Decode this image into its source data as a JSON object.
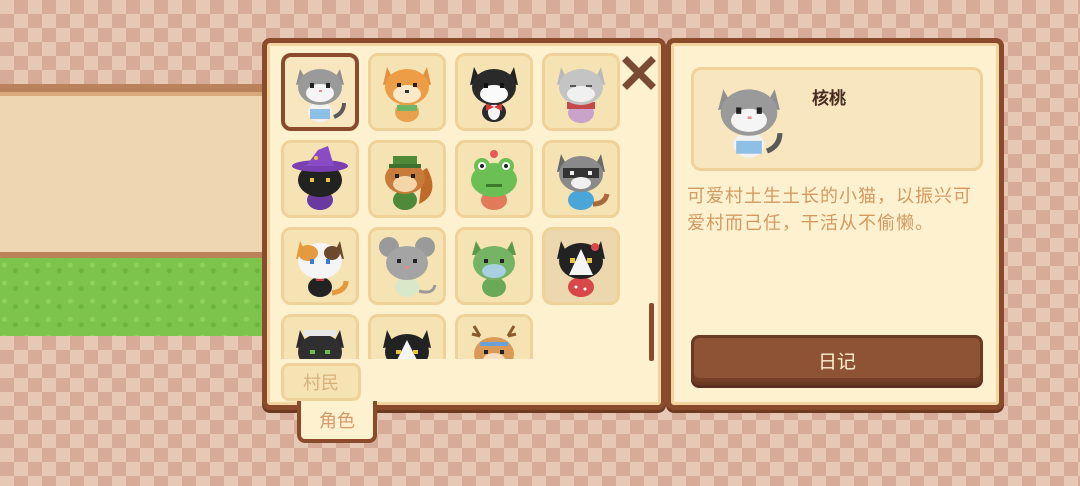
{
  "tabs": {
    "villagers": "村民",
    "characters": "角色"
  },
  "characters": [
    {
      "icon": "gray-cat-sailor-icon"
    },
    {
      "icon": "shiba-dog-icon"
    },
    {
      "icon": "black-cat-red-bowtie-icon"
    },
    {
      "icon": "gray-cat-scarf-icon"
    },
    {
      "icon": "black-cat-witch-hat-icon"
    },
    {
      "icon": "squirrel-hat-icon"
    },
    {
      "icon": "frog-icon"
    },
    {
      "icon": "raccoon-icon"
    },
    {
      "icon": "calico-cat-icon"
    },
    {
      "icon": "gray-mouse-icon"
    },
    {
      "icon": "green-lizard-icon"
    },
    {
      "icon": "tuxedo-cat-strawberry-icon"
    },
    {
      "icon": "black-cat-maid-icon"
    },
    {
      "icon": "tuxedo-cat-icon"
    },
    {
      "icon": "deer-icon"
    }
  ],
  "detail": {
    "name": "核桃",
    "portrait_icon": "gray-cat-sailor-icon",
    "description": "可爱村土生土长的小猫，以振兴可爱村而己任，干活从不偷懒。",
    "diary_button": "日记"
  },
  "colors": {
    "panel_border": "#8a4b2d",
    "panel_fill": "#fdf1cf",
    "text_tan": "#d29a62",
    "button_brown": "#8e5234"
  }
}
